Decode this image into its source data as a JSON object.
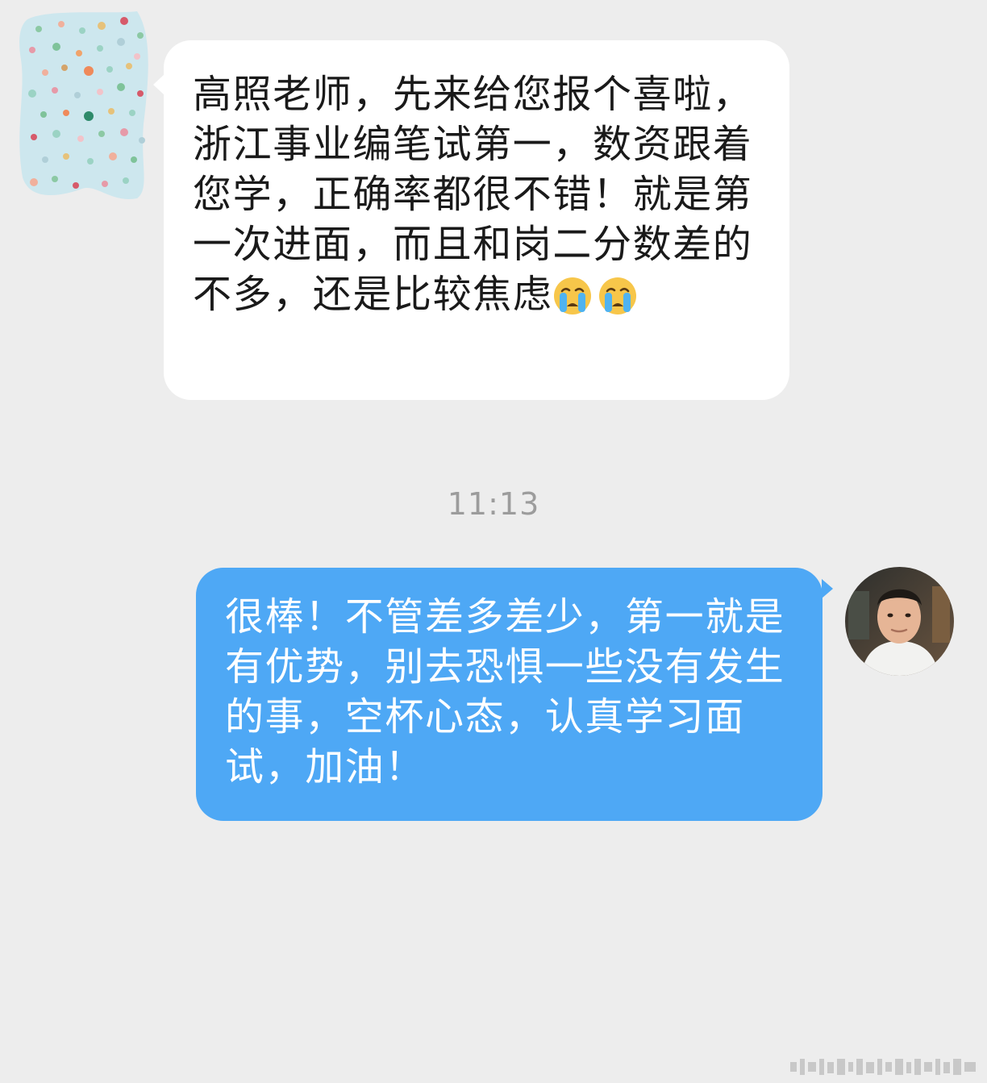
{
  "incoming": {
    "text": "高照老师，先来给您报个喜啦，浙江事业编笔试第一，数资跟着您学，正确率都很不错！就是第一次进面，而且和岗二分数差的不多，还是比较焦虑",
    "emojis": [
      "loudly-crying-face",
      "loudly-crying-face"
    ]
  },
  "timestamp": "11:13",
  "outgoing": {
    "text": "很棒！不管差多差少，第一就是有优势，别去恐惧一些没有发生的事，空杯心态，认真学习面试，加油！"
  },
  "colors": {
    "background": "#ededed",
    "incoming_bubble": "#ffffff",
    "outgoing_bubble": "#4ea8f5",
    "timestamp": "#9c9c9c"
  }
}
